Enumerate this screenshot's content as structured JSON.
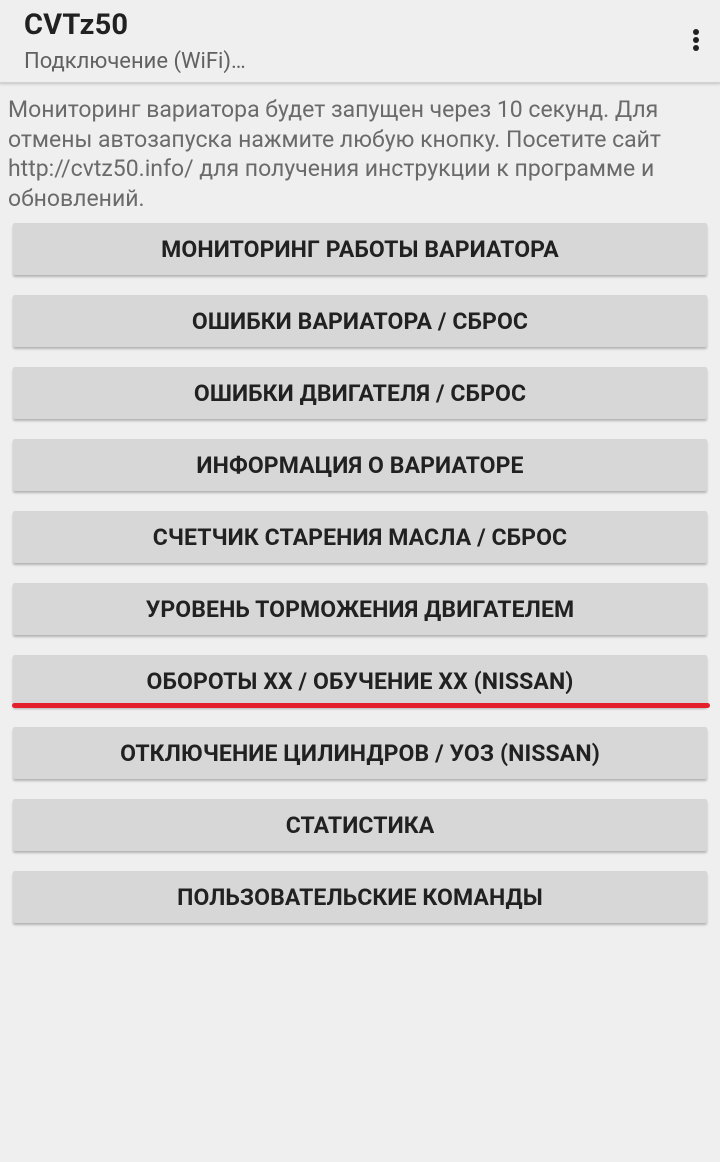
{
  "appbar": {
    "title": "CVTz50",
    "subtitle": "Подключение (WiFi)…",
    "overflow_icon": "more-vert-icon"
  },
  "notice": {
    "text": "Мониторинг вариатора будет запущен через 10 секунд. Для отмены автозапуска нажмите любую кнопку. Посетите сайт http://cvtz50.info/ для получения инструкции к программе и обновлений."
  },
  "buttons": [
    "МОНИТОРИНГ РАБОТЫ ВАРИАТОРА",
    "ОШИБКИ ВАРИАТОРА / СБРОС",
    "ОШИБКИ ДВИГАТЕЛЯ / СБРОС",
    "ИНФОРМАЦИЯ О ВАРИАТОРЕ",
    "СЧЕТЧИК СТАРЕНИЯ МАСЛА / СБРОС",
    "УРОВЕНЬ ТОРМОЖЕНИЯ ДВИГАТЕЛЕМ",
    "ОБОРОТЫ ХХ / ОБУЧЕНИЕ ХХ (NISSAN)",
    "ОТКЛЮЧЕНИЕ ЦИЛИНДРОВ / УОЗ (NISSAN)",
    "СТАТИСТИКА",
    "ПОЛЬЗОВАТЕЛЬСКИЕ КОМАНДЫ"
  ],
  "colors": {
    "background": "#efefef",
    "button": "#d7d7d7",
    "highlight_underline": "#e3202b"
  }
}
